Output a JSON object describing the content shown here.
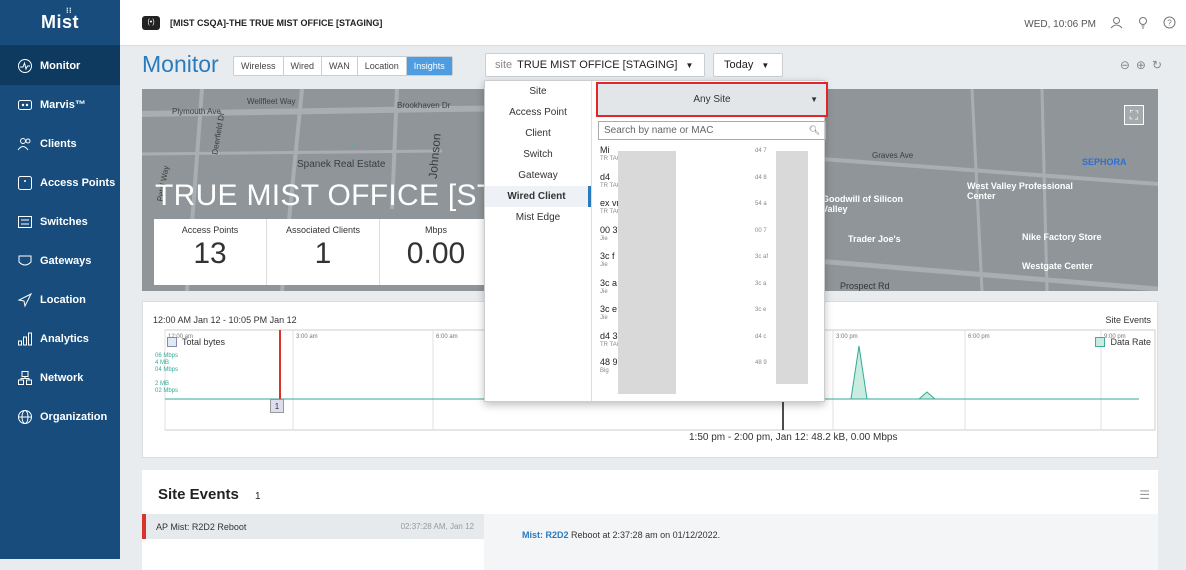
{
  "brand": {
    "logo": "Mist"
  },
  "org": {
    "badge": "(•)",
    "name": "[MIST CSQA]-THE TRUE MIST OFFICE [STAGING]"
  },
  "top_right": {
    "datetime": "WED, 10:06 PM"
  },
  "sidebar": {
    "items": [
      {
        "label": "Monitor",
        "icon": "monitor-icon"
      },
      {
        "label": "Marvis™",
        "icon": "marvis-icon"
      },
      {
        "label": "Clients",
        "icon": "clients-icon"
      },
      {
        "label": "Access Points",
        "icon": "access-point-icon"
      },
      {
        "label": "Switches",
        "icon": "switch-icon"
      },
      {
        "label": "Gateways",
        "icon": "gateway-icon"
      },
      {
        "label": "Location",
        "icon": "location-icon"
      },
      {
        "label": "Analytics",
        "icon": "analytics-icon"
      },
      {
        "label": "Network",
        "icon": "network-icon"
      },
      {
        "label": "Organization",
        "icon": "organization-icon"
      }
    ]
  },
  "monitor": {
    "title": "Monitor",
    "tabs": [
      "Wireless",
      "Wired",
      "WAN",
      "Location",
      "Insights"
    ],
    "active_tab": "Insights",
    "site_label": "site",
    "site_value": "TRUE MIST OFFICE [STAGING]",
    "period": "Today"
  },
  "map": {
    "site_name": "TRUE MIST OFFICE [STAGING]",
    "streets": [
      "Plymouth Ave",
      "Wellfleet Way",
      "Brookhaven Dr",
      "Johnson",
      "Spanek Real Estate",
      "Graves Ave",
      "Petal Way",
      "Deerfield Dr"
    ],
    "pois": [
      "SEPHORA",
      "West Valley Professional Center",
      "Goodwill of Silicon Valley",
      "Trader Joe's",
      "Nike Factory Store",
      "Westgate Center",
      "Prospect Rd"
    ]
  },
  "stats": [
    {
      "title": "Access Points",
      "value": "13"
    },
    {
      "title": "Associated Clients",
      "value": "1"
    },
    {
      "title": "Mbps",
      "value": "0.00"
    }
  ],
  "chart": {
    "range": "12:00 AM Jan 12 - 10:05 PM Jan 12",
    "legend_left": "Total bytes",
    "legend_right": "Data Rate",
    "site_events": "Site Events",
    "ticks": [
      "12:00 am",
      "3:00 am",
      "6:00 am",
      "3:00 pm",
      "6:00 pm",
      "9:00 pm"
    ],
    "y_labels": [
      "06 Mbps",
      "4 MB",
      "04 Mbps",
      "2 MB",
      "02 Mbps"
    ],
    "marker": "1",
    "hover_text": "1:50 pm - 2:00 pm, Jan 12: 48.2 kB, 0.00 Mbps"
  },
  "events": {
    "title": "Site Events",
    "count": "1",
    "row_label": "AP Mist: R2D2 Reboot",
    "row_time": "02:37:28 AM, Jan 12",
    "detail_link": "Mist: R2D2",
    "detail_text": " Reboot at 2:37:28 am on 01/12/2022."
  },
  "dropdown": {
    "categories": [
      "Site",
      "Access Point",
      "Client",
      "Switch",
      "Gateway",
      "Wired Client",
      "Mist Edge"
    ],
    "selected_category": "Wired Client",
    "any_site": "Any Site",
    "search_placeholder": "Search by name or MAC",
    "items": [
      {
        "name": "Mi",
        "sub": "TR            TAGING]",
        "mac": "d4            7"
      },
      {
        "name": "d4",
        "sub": "TR            TAGING]",
        "mac": "d4            8"
      },
      {
        "name": "ex            vr_closet",
        "sub": "TR            TAGING]",
        "mac": "54            a"
      },
      {
        "name": "00            37",
        "sub": "Jie",
        "mac": "00            7"
      },
      {
        "name": "3c            f",
        "sub": "Jie",
        "mac": "3c            af"
      },
      {
        "name": "3c            a",
        "sub": "Jie",
        "mac": "3c            a"
      },
      {
        "name": "3c            e",
        "sub": "Jie",
        "mac": "3c            e"
      },
      {
        "name": "d4            3c",
        "sub": "TR            TAGING]",
        "mac": "d4            c"
      },
      {
        "name": "48            9",
        "sub": "Big",
        "mac": "48            9"
      }
    ]
  },
  "colors": {
    "sidebar": "#174c7c",
    "accent": "#2a7bbd",
    "highlight": "#e0252c"
  }
}
